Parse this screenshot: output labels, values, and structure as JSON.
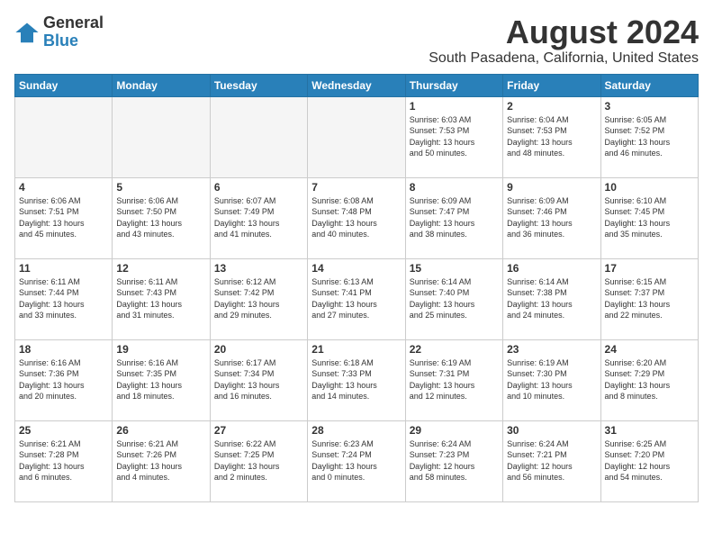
{
  "logo": {
    "general": "General",
    "blue": "Blue"
  },
  "title": "August 2024",
  "subtitle": "South Pasadena, California, United States",
  "days_of_week": [
    "Sunday",
    "Monday",
    "Tuesday",
    "Wednesday",
    "Thursday",
    "Friday",
    "Saturday"
  ],
  "weeks": [
    [
      {
        "day": "",
        "info": ""
      },
      {
        "day": "",
        "info": ""
      },
      {
        "day": "",
        "info": ""
      },
      {
        "day": "",
        "info": ""
      },
      {
        "day": "1",
        "info": "Sunrise: 6:03 AM\nSunset: 7:53 PM\nDaylight: 13 hours\nand 50 minutes."
      },
      {
        "day": "2",
        "info": "Sunrise: 6:04 AM\nSunset: 7:53 PM\nDaylight: 13 hours\nand 48 minutes."
      },
      {
        "day": "3",
        "info": "Sunrise: 6:05 AM\nSunset: 7:52 PM\nDaylight: 13 hours\nand 46 minutes."
      }
    ],
    [
      {
        "day": "4",
        "info": "Sunrise: 6:06 AM\nSunset: 7:51 PM\nDaylight: 13 hours\nand 45 minutes."
      },
      {
        "day": "5",
        "info": "Sunrise: 6:06 AM\nSunset: 7:50 PM\nDaylight: 13 hours\nand 43 minutes."
      },
      {
        "day": "6",
        "info": "Sunrise: 6:07 AM\nSunset: 7:49 PM\nDaylight: 13 hours\nand 41 minutes."
      },
      {
        "day": "7",
        "info": "Sunrise: 6:08 AM\nSunset: 7:48 PM\nDaylight: 13 hours\nand 40 minutes."
      },
      {
        "day": "8",
        "info": "Sunrise: 6:09 AM\nSunset: 7:47 PM\nDaylight: 13 hours\nand 38 minutes."
      },
      {
        "day": "9",
        "info": "Sunrise: 6:09 AM\nSunset: 7:46 PM\nDaylight: 13 hours\nand 36 minutes."
      },
      {
        "day": "10",
        "info": "Sunrise: 6:10 AM\nSunset: 7:45 PM\nDaylight: 13 hours\nand 35 minutes."
      }
    ],
    [
      {
        "day": "11",
        "info": "Sunrise: 6:11 AM\nSunset: 7:44 PM\nDaylight: 13 hours\nand 33 minutes."
      },
      {
        "day": "12",
        "info": "Sunrise: 6:11 AM\nSunset: 7:43 PM\nDaylight: 13 hours\nand 31 minutes."
      },
      {
        "day": "13",
        "info": "Sunrise: 6:12 AM\nSunset: 7:42 PM\nDaylight: 13 hours\nand 29 minutes."
      },
      {
        "day": "14",
        "info": "Sunrise: 6:13 AM\nSunset: 7:41 PM\nDaylight: 13 hours\nand 27 minutes."
      },
      {
        "day": "15",
        "info": "Sunrise: 6:14 AM\nSunset: 7:40 PM\nDaylight: 13 hours\nand 25 minutes."
      },
      {
        "day": "16",
        "info": "Sunrise: 6:14 AM\nSunset: 7:38 PM\nDaylight: 13 hours\nand 24 minutes."
      },
      {
        "day": "17",
        "info": "Sunrise: 6:15 AM\nSunset: 7:37 PM\nDaylight: 13 hours\nand 22 minutes."
      }
    ],
    [
      {
        "day": "18",
        "info": "Sunrise: 6:16 AM\nSunset: 7:36 PM\nDaylight: 13 hours\nand 20 minutes."
      },
      {
        "day": "19",
        "info": "Sunrise: 6:16 AM\nSunset: 7:35 PM\nDaylight: 13 hours\nand 18 minutes."
      },
      {
        "day": "20",
        "info": "Sunrise: 6:17 AM\nSunset: 7:34 PM\nDaylight: 13 hours\nand 16 minutes."
      },
      {
        "day": "21",
        "info": "Sunrise: 6:18 AM\nSunset: 7:33 PM\nDaylight: 13 hours\nand 14 minutes."
      },
      {
        "day": "22",
        "info": "Sunrise: 6:19 AM\nSunset: 7:31 PM\nDaylight: 13 hours\nand 12 minutes."
      },
      {
        "day": "23",
        "info": "Sunrise: 6:19 AM\nSunset: 7:30 PM\nDaylight: 13 hours\nand 10 minutes."
      },
      {
        "day": "24",
        "info": "Sunrise: 6:20 AM\nSunset: 7:29 PM\nDaylight: 13 hours\nand 8 minutes."
      }
    ],
    [
      {
        "day": "25",
        "info": "Sunrise: 6:21 AM\nSunset: 7:28 PM\nDaylight: 13 hours\nand 6 minutes."
      },
      {
        "day": "26",
        "info": "Sunrise: 6:21 AM\nSunset: 7:26 PM\nDaylight: 13 hours\nand 4 minutes."
      },
      {
        "day": "27",
        "info": "Sunrise: 6:22 AM\nSunset: 7:25 PM\nDaylight: 13 hours\nand 2 minutes."
      },
      {
        "day": "28",
        "info": "Sunrise: 6:23 AM\nSunset: 7:24 PM\nDaylight: 13 hours\nand 0 minutes."
      },
      {
        "day": "29",
        "info": "Sunrise: 6:24 AM\nSunset: 7:23 PM\nDaylight: 12 hours\nand 58 minutes."
      },
      {
        "day": "30",
        "info": "Sunrise: 6:24 AM\nSunset: 7:21 PM\nDaylight: 12 hours\nand 56 minutes."
      },
      {
        "day": "31",
        "info": "Sunrise: 6:25 AM\nSunset: 7:20 PM\nDaylight: 12 hours\nand 54 minutes."
      }
    ]
  ]
}
